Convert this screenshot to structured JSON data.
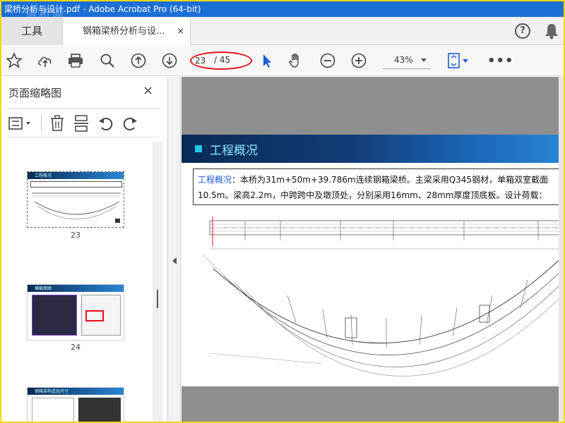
{
  "window": {
    "title": "梁桥分析与设计.pdf - Adobe Acrobat Pro (64-bit)",
    "watermark": "道桥网"
  },
  "tabs": {
    "tools_label": "工具",
    "doc_tab_label": "钢箱梁桥分析与设...",
    "doc_tab_close": "×",
    "help_glyph": "?"
  },
  "toolbar": {
    "current_page": "23",
    "total_pages": "/ 45",
    "zoom": "43%",
    "more_glyph": "•••",
    "icons": [
      "bookmark-star-icon",
      "upload-cloud-icon",
      "print-icon",
      "zoom-search-icon",
      "page-up-icon",
      "page-down-icon",
      "select-cursor-icon",
      "hand-tool-icon",
      "zoom-out-icon",
      "zoom-in-icon",
      "fit-page-icon"
    ]
  },
  "sidebar": {
    "title": "页面缩略图",
    "close_glyph": "×",
    "thumbnails": [
      {
        "page": "23",
        "heading": "工程概况"
      },
      {
        "page": "24",
        "heading": "横截面图"
      },
      {
        "page": "",
        "heading": "钢箱梁构造及尺寸"
      }
    ]
  },
  "document": {
    "section_title": "工程概况",
    "overview_label": "工程概况",
    "overview_line1": "：本桥为31m+50m+39.786m连续钢箱梁桥。主梁采用Q345钢材，单箱双室截面",
    "overview_line2": "10.5m。梁高2.2m，中跨跨中及墩顶处，分别采用16mm、28mm厚度顶底板。设计荷载："
  },
  "colors": {
    "titlebar": "#1c6fd6",
    "accent_blue": "#1a5bd0",
    "highlight_red": "#e8101b",
    "frame_yellow": "#f2d800",
    "header_dark": "#0a2a55"
  }
}
